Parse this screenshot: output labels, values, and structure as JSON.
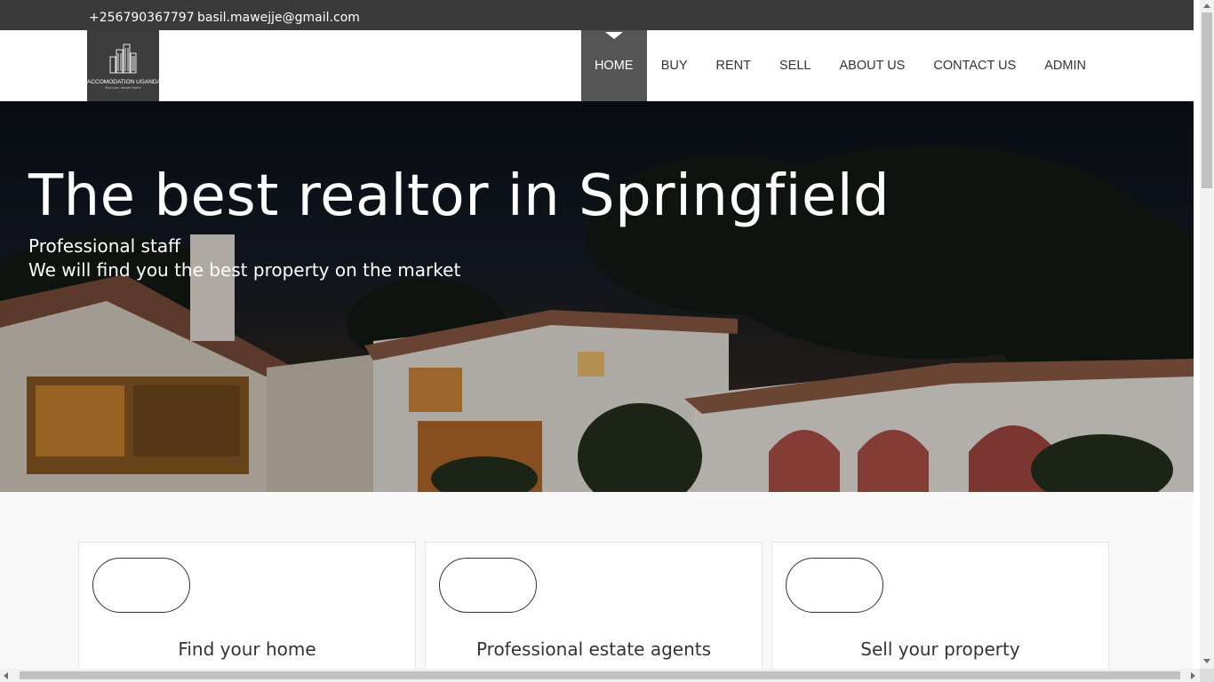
{
  "topbar": {
    "phone": "+256790367797",
    "email": "basil.mawejje@gmail.com"
  },
  "logo": {
    "name": "ACCOMODATION UGANDA",
    "tagline": "Find your dream Home",
    "icon": "buildings-icon"
  },
  "nav": {
    "items": [
      {
        "label": "HOME",
        "active": true
      },
      {
        "label": "BUY",
        "active": false
      },
      {
        "label": "RENT",
        "active": false
      },
      {
        "label": "SELL",
        "active": false
      },
      {
        "label": "ABOUT US",
        "active": false
      },
      {
        "label": "CONTACT US",
        "active": false
      },
      {
        "label": "ADMIN",
        "active": false
      }
    ]
  },
  "hero": {
    "title": "The best realtor in Springfield",
    "line1": "Professional staff",
    "line2": "We will find you the best property on the market"
  },
  "features": [
    {
      "title": "Find your home"
    },
    {
      "title": "Professional estate agents"
    },
    {
      "title": "Sell your property"
    }
  ],
  "colors": {
    "topbar": "#3a3a3a",
    "nav_active": "#555555",
    "page_bg": "#f9f9f9"
  }
}
